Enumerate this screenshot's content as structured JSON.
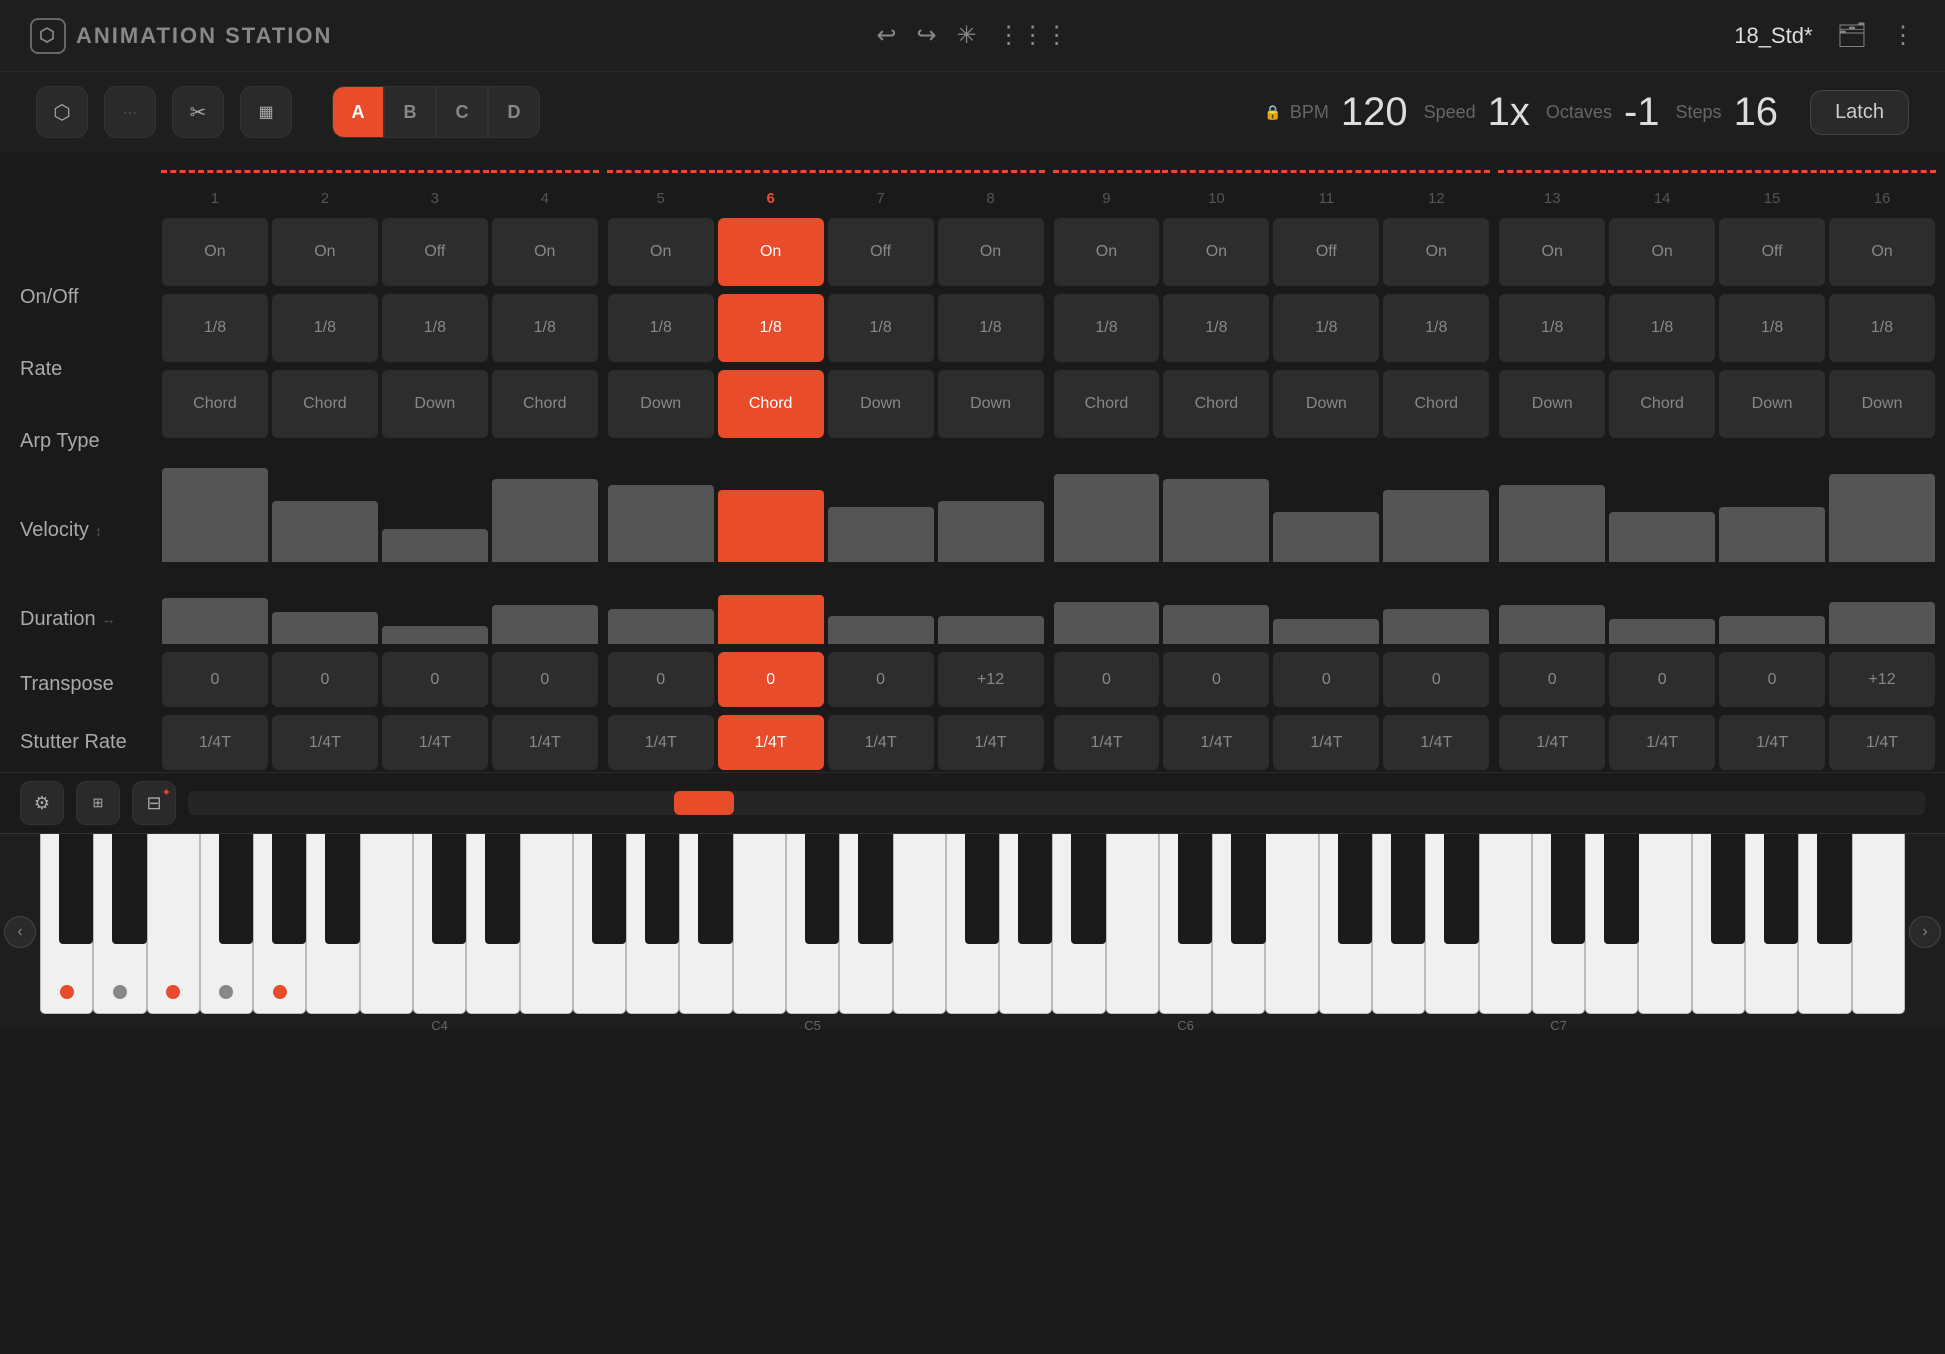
{
  "header": {
    "app_name": "ANIMATION STATION",
    "preset_name": "18_Std*"
  },
  "toolbar": {
    "bpm_label": "BPM",
    "bpm_value": "120",
    "speed_label": "Speed",
    "speed_value": "1x",
    "octaves_label": "Octaves",
    "octaves_value": "-1",
    "steps_label": "Steps",
    "steps_value": "16",
    "latch_label": "Latch",
    "patterns": [
      "A",
      "B",
      "C",
      "D"
    ],
    "active_pattern": "A"
  },
  "grid": {
    "active_step": 6,
    "steps": [
      1,
      2,
      3,
      4,
      5,
      6,
      7,
      8,
      9,
      10,
      11,
      12,
      13,
      14,
      15,
      16
    ],
    "onoff": [
      "On",
      "On",
      "Off",
      "On",
      "On",
      "On",
      "Off",
      "On",
      "On",
      "On",
      "Off",
      "On",
      "On",
      "On",
      "Off",
      "On"
    ],
    "rate": [
      "1/8",
      "1/8",
      "1/8",
      "1/8",
      "1/8",
      "1/8",
      "1/8",
      "1/8",
      "1/8",
      "1/8",
      "1/8",
      "1/8",
      "1/8",
      "1/8",
      "1/8",
      "1/8"
    ],
    "arp_type": [
      "Chord",
      "Chord",
      "Down",
      "Chord",
      "Down",
      "Chord",
      "Down",
      "Down",
      "Chord",
      "Chord",
      "Down",
      "Chord",
      "Down",
      "Chord",
      "Down",
      "Down"
    ],
    "velocity": [
      85,
      55,
      30,
      75,
      70,
      65,
      50,
      55,
      80,
      75,
      45,
      65,
      70,
      45,
      50,
      80
    ],
    "duration": [
      65,
      45,
      25,
      55,
      50,
      70,
      40,
      40,
      60,
      55,
      35,
      50,
      55,
      35,
      40,
      60
    ],
    "transpose": [
      "0",
      "0",
      "0",
      "0",
      "0",
      "0",
      "0",
      "+12",
      "0",
      "0",
      "0",
      "0",
      "0",
      "0",
      "0",
      "+12"
    ],
    "stutter_rate": [
      "1/4T",
      "1/4T",
      "1/4T",
      "1/4T",
      "1/4T",
      "1/4T",
      "1/4T",
      "1/4T",
      "1/4T",
      "1/4T",
      "1/4T",
      "1/4T",
      "1/4T",
      "1/4T",
      "1/4T",
      "1/4T"
    ]
  },
  "row_labels": {
    "onoff": "On/Off",
    "rate": "Rate",
    "arp_type": "Arp Type",
    "velocity": "Velocity",
    "duration": "Duration",
    "transpose": "Transpose",
    "stutter_rate": "Stutter Rate"
  },
  "piano": {
    "labels": [
      "C4",
      "C5",
      "C6",
      "C7"
    ]
  }
}
